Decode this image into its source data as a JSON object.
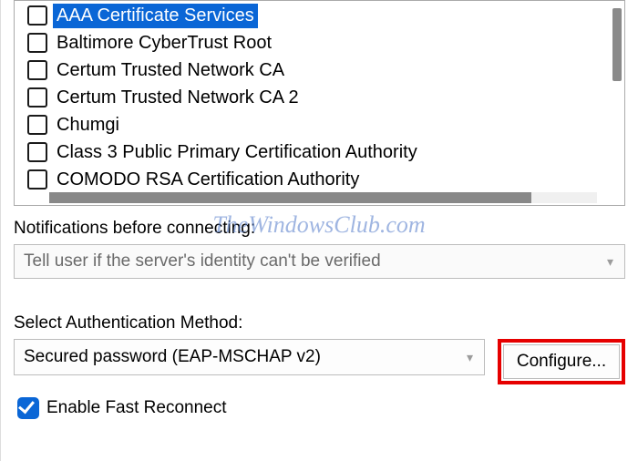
{
  "cert_list": {
    "items": [
      {
        "label": "AAA Certificate Services",
        "selected": true
      },
      {
        "label": "Baltimore CyberTrust Root",
        "selected": false
      },
      {
        "label": "Certum Trusted Network CA",
        "selected": false
      },
      {
        "label": "Certum Trusted Network CA 2",
        "selected": false
      },
      {
        "label": "Chumgi",
        "selected": false
      },
      {
        "label": "Class 3 Public Primary Certification Authority",
        "selected": false
      },
      {
        "label": "COMODO RSA Certification Authority",
        "selected": false
      }
    ]
  },
  "notifications": {
    "label": "Notifications before connecting:",
    "value": "Tell user if the server's identity can't be verified"
  },
  "auth": {
    "label": "Select Authentication Method:",
    "value": "Secured password (EAP-MSCHAP v2)",
    "configure_label": "Configure..."
  },
  "fast_reconnect": {
    "label": "Enable Fast Reconnect",
    "checked": true
  },
  "watermark": "TheWindowsClub.com",
  "colors": {
    "selection_bg": "#0a66d6",
    "highlight_border": "#e60000"
  }
}
